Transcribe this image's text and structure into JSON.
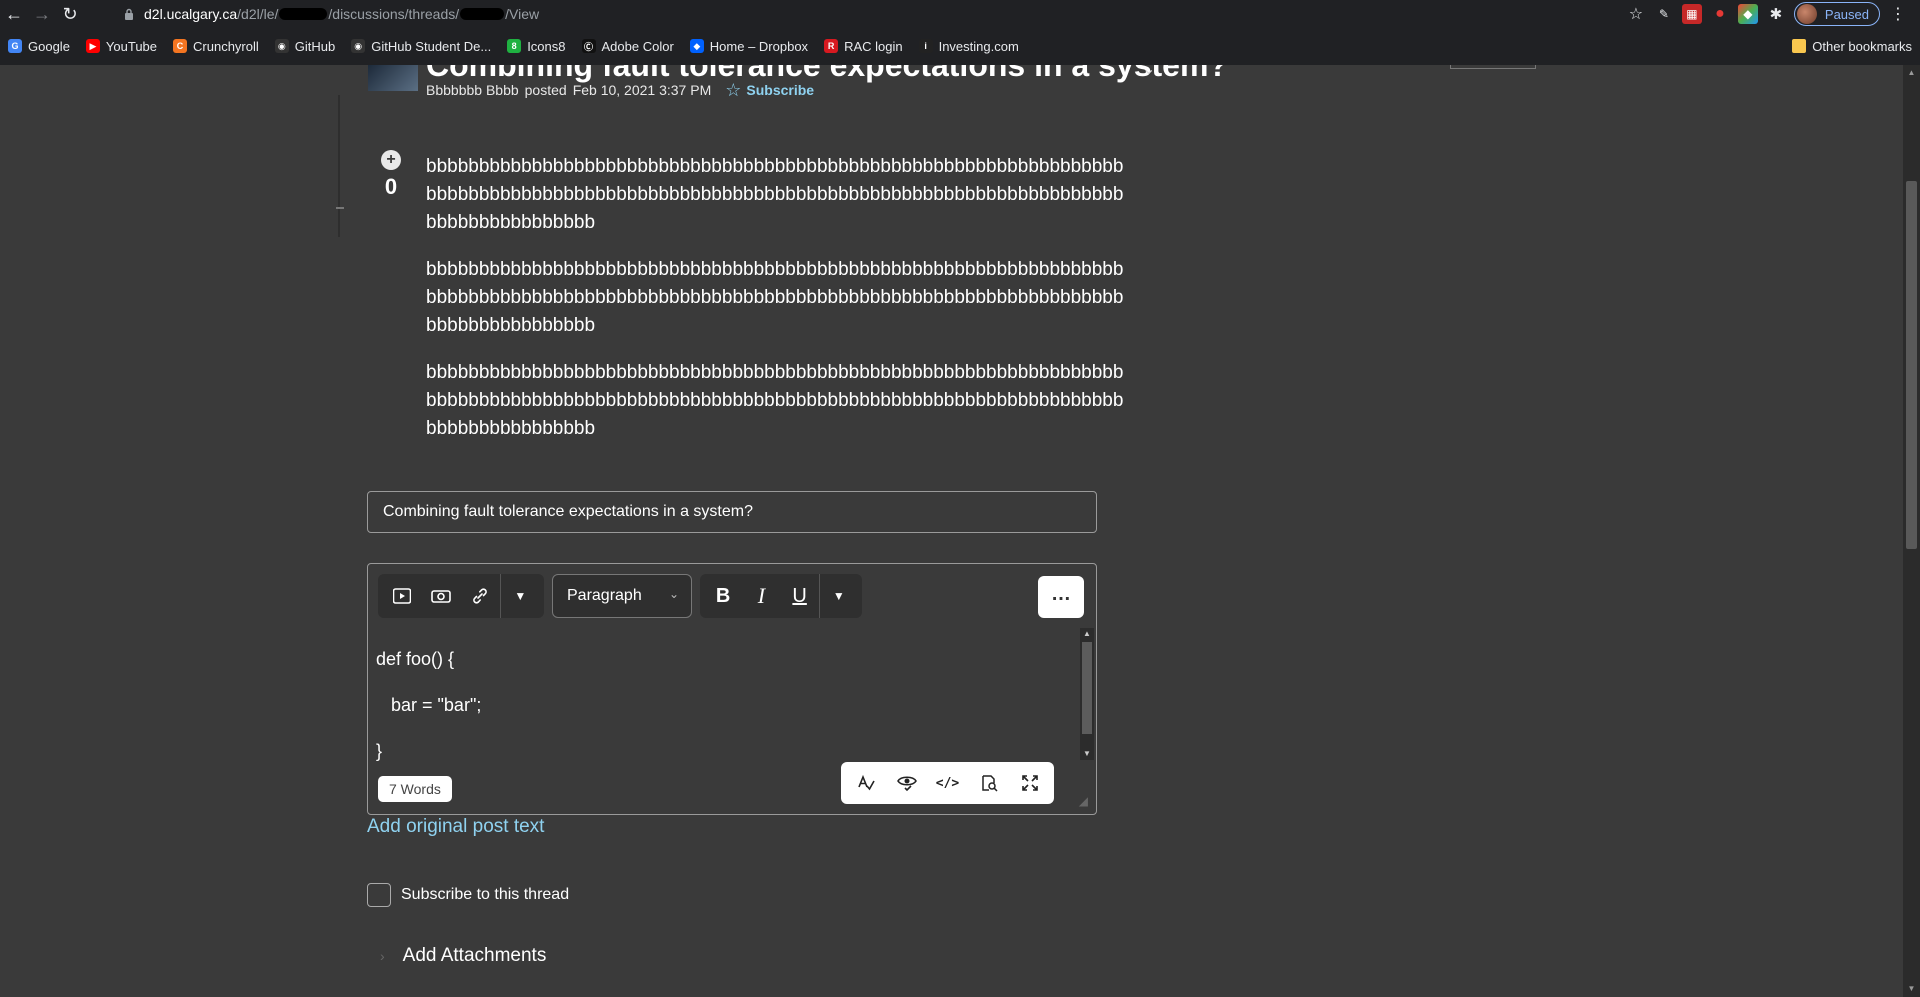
{
  "browser": {
    "url_host": "d2l.ucalgary.ca",
    "url_path_1": "/d2l/le/",
    "url_path_2": "/discussions/threads/",
    "url_path_3": "/View",
    "profile_label": "Paused",
    "bookmarks": [
      {
        "label": "Google",
        "icon": "google-icon",
        "color": "#4285f4"
      },
      {
        "label": "YouTube",
        "icon": "youtube-icon",
        "color": "#ff0000"
      },
      {
        "label": "Crunchyroll",
        "icon": "crunchyroll-icon",
        "color": "#f47521"
      },
      {
        "label": "GitHub",
        "icon": "github-icon",
        "color": "#333333"
      },
      {
        "label": "GitHub Student De...",
        "icon": "github-icon",
        "color": "#333333"
      },
      {
        "label": "Icons8",
        "icon": "icons8-icon",
        "color": "#1fb141"
      },
      {
        "label": "Adobe Color",
        "icon": "adobe-color-icon",
        "color": "#111111"
      },
      {
        "label": "Home – Dropbox",
        "icon": "dropbox-icon",
        "color": "#0061fe"
      },
      {
        "label": "RAC login",
        "icon": "rac-icon",
        "color": "#d71920"
      },
      {
        "label": "Investing.com",
        "icon": "investing-icon",
        "color": "#222222"
      }
    ],
    "other_bookmarks": "Other bookmarks"
  },
  "post": {
    "title": "Combining fault tolerance expectations in a system?",
    "author": "Bbbbbbb Bbbb",
    "posted_label": "posted",
    "date": "Feb 10, 2021 3:37 PM",
    "subscribe_label": "Subscribe",
    "vote_count": "0",
    "paragraphs": [
      "bbbbbbbbbbbbbbbbbbbbbbbbbbbbbbbbbbbbbbbbbbbbbbbbbbbbbbbbbbbbbbbbbbbbbbbbbbbbbbbbbbbbbbbbbbbbbbbbbbbbbbbbbbbbbbbbbbbbbbbbbbbbbbbbbbbbbbbbbbbbbbbbbbbb",
      "bbbbbbbbbbbbbbbbbbbbbbbbbbbbbbbbbbbbbbbbbbbbbbbbbbbbbbbbbbbbbbbbbbbbbbbbbbbbbbbbbbbbbbbbbbbbbbbbbbbbbbbbbbbbbbbbbbbbbbbbbbbbbbbbbbbbbbbbbbbbbbbbbbbb",
      "bbbbbbbbbbbbbbbbbbbbbbbbbbbbbbbbbbbbbbbbbbbbbbbbbbbbbbbbbbbbbbbbbbbbbbbbbbbbbbbbbbbbbbbbbbbbbbbbbbbbbbbbbbbbbbbbbbbbbbbbbbbbbbbbbbbbbbbbbbbbbbbbbbbb"
    ]
  },
  "reply": {
    "subject_value": "Combining fault tolerance expectations in a system?",
    "format_select": "Paragraph",
    "code_lines": [
      "def foo() {",
      "   bar = \"bar\";",
      "}"
    ],
    "word_count": "7 Words",
    "add_original_link": "Add original post text",
    "subscribe_checkbox_label": "Subscribe to this thread",
    "attachments_label": "Add Attachments"
  }
}
